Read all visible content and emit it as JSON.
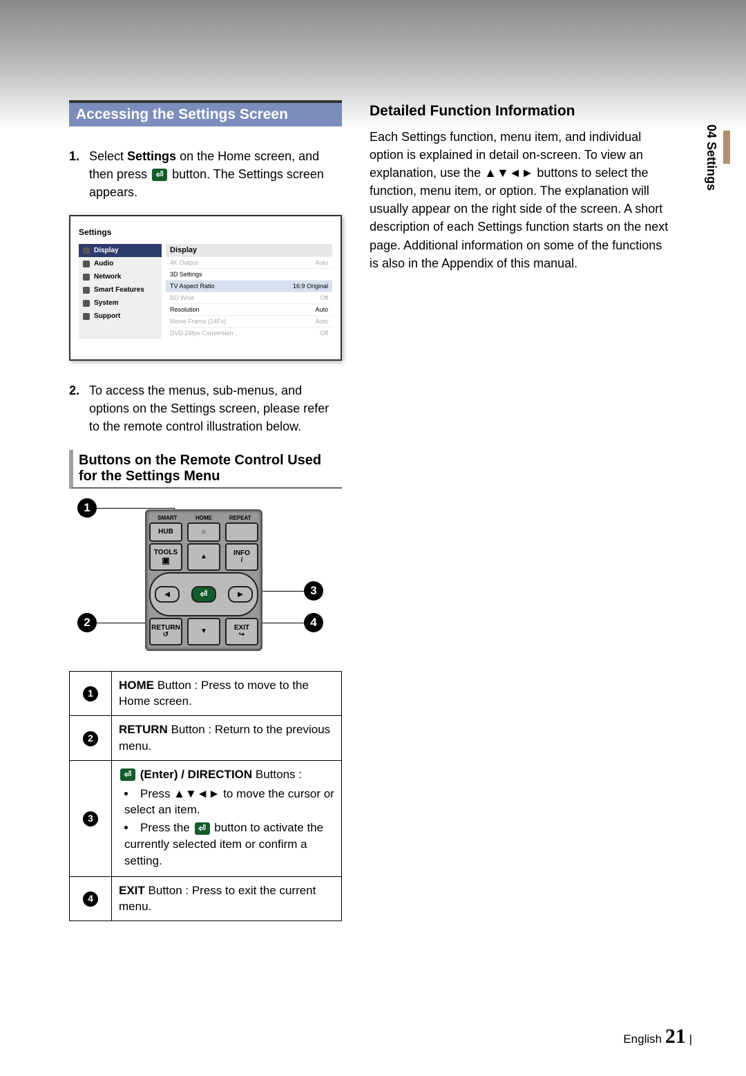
{
  "side_tab": "04  Settings",
  "banner": "Accessing the Settings Screen",
  "step1_num": "1.",
  "step1_a": "Select ",
  "step1_b": "Settings",
  "step1_c": " on the Home screen, and then press ",
  "step1_d": " button. The Settings screen appears.",
  "step2_num": "2.",
  "step2_text": "To access the menus, sub-menus, and options on the Settings screen, please refer to the remote control illustration below.",
  "subhead1": "Buttons on the Remote Control Used for the Settings Menu",
  "settings_panel": {
    "title": "Settings",
    "sidebar": [
      "Display",
      "Audio",
      "Network",
      "Smart Features",
      "System",
      "Support"
    ],
    "main_title": "Display",
    "rows": [
      {
        "label": "4K Output",
        "value": "Auto",
        "dim": true
      },
      {
        "label": "3D Settings",
        "value": ""
      },
      {
        "label": "TV Aspect Ratio",
        "value": "16:9 Original",
        "active": true
      },
      {
        "label": "BD Wise",
        "value": "Off",
        "dim": true
      },
      {
        "label": "Resolution",
        "value": "Auto"
      },
      {
        "label": "Movie Frame (24Fs)",
        "value": "Auto",
        "dim": true
      },
      {
        "label": "DVD 24fps Conversion",
        "value": "Off",
        "dim": true
      }
    ]
  },
  "remote": {
    "top": [
      "SMART",
      "HOME",
      "REPEAT"
    ],
    "hub": "HUB",
    "tools": "TOOLS",
    "info": "INFO",
    "return": "RETURN",
    "exit": "EXIT"
  },
  "co": {
    "1": "1",
    "2": "2",
    "3": "3",
    "4": "4"
  },
  "table": {
    "r1_bold": "HOME",
    "r1_rest": " Button : Press to move to the Home screen.",
    "r2_bold": "RETURN",
    "r2_rest": " Button : Return to the previous menu.",
    "r3_bold": " (Enter) / DIRECTION",
    "r3_rest": " Buttons :",
    "r3_b1a": "Press ▲▼◄► to move the cursor or select an item.",
    "r3_b2a": "Press the ",
    "r3_b2b": " button to activate the currently selected item or confirm a setting.",
    "r4_bold": "EXIT",
    "r4_rest": " Button : Press to exit the current menu."
  },
  "right": {
    "heading": "Detailed Function Information",
    "para": "Each Settings function, menu item, and individual option is explained in detail on-screen. To view an explanation, use the ▲▼◄► buttons to select the function, menu item, or option. The explanation will usually appear on the right side of the screen. A short description of each Settings function starts on the next page. Additional information on some of the functions is also in the Appendix of this manual."
  },
  "footer": {
    "lang": "English",
    "page": "21",
    "pipe": "|"
  }
}
